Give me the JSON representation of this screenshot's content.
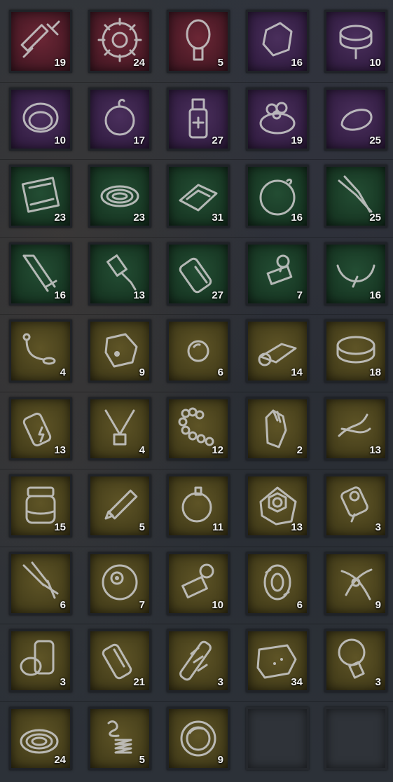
{
  "inventory": {
    "items": [
      {
        "icon": "syringe-icon",
        "rarity": "red",
        "count": "19"
      },
      {
        "icon": "gear-icon",
        "rarity": "red",
        "count": "24"
      },
      {
        "icon": "bulb-icon",
        "rarity": "red",
        "count": "5"
      },
      {
        "icon": "stone-icon",
        "rarity": "purple",
        "count": "16"
      },
      {
        "icon": "seal-icon",
        "rarity": "purple",
        "count": "10"
      },
      {
        "icon": "ring-band-icon",
        "rarity": "purple",
        "count": "10"
      },
      {
        "icon": "pendant-icon",
        "rarity": "purple",
        "count": "17"
      },
      {
        "icon": "medicine-bottle-icon",
        "rarity": "purple",
        "count": "27"
      },
      {
        "icon": "jeweled-ring-icon",
        "rarity": "purple",
        "count": "19"
      },
      {
        "icon": "wire-loop-icon",
        "rarity": "purple",
        "count": "25"
      },
      {
        "icon": "bandage-pack-icon",
        "rarity": "green",
        "count": "23"
      },
      {
        "icon": "rope-coil-icon",
        "rarity": "green",
        "count": "23"
      },
      {
        "icon": "gauze-pad-icon",
        "rarity": "green",
        "count": "31"
      },
      {
        "icon": "ornament-icon",
        "rarity": "green",
        "count": "16"
      },
      {
        "icon": "pliers-icon",
        "rarity": "green",
        "count": "25"
      },
      {
        "icon": "hacksaw-icon",
        "rarity": "green",
        "count": "16"
      },
      {
        "icon": "spark-plug-icon",
        "rarity": "green",
        "count": "13"
      },
      {
        "icon": "battery-icon",
        "rarity": "green",
        "count": "27"
      },
      {
        "icon": "stamp-icon",
        "rarity": "green",
        "count": "7"
      },
      {
        "icon": "necklace-icon",
        "rarity": "green",
        "count": "16"
      },
      {
        "icon": "beads-string-icon",
        "rarity": "yellow",
        "count": "4"
      },
      {
        "icon": "coin-tag-icon",
        "rarity": "yellow",
        "count": "9"
      },
      {
        "icon": "marble-icon",
        "rarity": "yellow",
        "count": "6"
      },
      {
        "icon": "cloth-roll-icon",
        "rarity": "yellow",
        "count": "14"
      },
      {
        "icon": "bracelet-icon",
        "rarity": "yellow",
        "count": "18"
      },
      {
        "icon": "cell-battery-icon",
        "rarity": "yellow",
        "count": "13"
      },
      {
        "icon": "light-fixture-icon",
        "rarity": "yellow",
        "count": "4"
      },
      {
        "icon": "prayer-beads-icon",
        "rarity": "yellow",
        "count": "12"
      },
      {
        "icon": "gloves-icon",
        "rarity": "yellow",
        "count": "2"
      },
      {
        "icon": "thread-icon",
        "rarity": "yellow",
        "count": "13"
      },
      {
        "icon": "jar-icon",
        "rarity": "yellow",
        "count": "15"
      },
      {
        "icon": "pencil-icon",
        "rarity": "yellow",
        "count": "5"
      },
      {
        "icon": "bomb-ornament-icon",
        "rarity": "yellow",
        "count": "11"
      },
      {
        "icon": "pillow-hex-nut-icon",
        "rarity": "yellow",
        "count": "13"
      },
      {
        "icon": "socket-icon",
        "rarity": "yellow",
        "count": "3"
      },
      {
        "icon": "clamp-icon",
        "rarity": "yellow",
        "count": "6"
      },
      {
        "icon": "eyeball-icon",
        "rarity": "yellow",
        "count": "7"
      },
      {
        "icon": "rubber-stamp-icon",
        "rarity": "yellow",
        "count": "10"
      },
      {
        "icon": "spool-icon",
        "rarity": "yellow",
        "count": "6"
      },
      {
        "icon": "ribbon-icon",
        "rarity": "yellow",
        "count": "9"
      },
      {
        "icon": "bandage-roll-icon",
        "rarity": "yellow",
        "count": "3"
      },
      {
        "icon": "aa-battery-icon",
        "rarity": "yellow",
        "count": "21"
      },
      {
        "icon": "tape-stick-icon",
        "rarity": "yellow",
        "count": "3"
      },
      {
        "icon": "rag-icon",
        "rarity": "yellow",
        "count": "34"
      },
      {
        "icon": "light-bulb-icon",
        "rarity": "yellow",
        "count": "3"
      },
      {
        "icon": "rope-bundle-icon",
        "rarity": "yellow",
        "count": "24"
      },
      {
        "icon": "spring-icon",
        "rarity": "yellow",
        "count": "5"
      },
      {
        "icon": "lens-icon",
        "rarity": "yellow",
        "count": "9"
      }
    ],
    "empty_slots": 2
  },
  "colors": {
    "red": "#4a1a26",
    "purple": "#351f45",
    "green": "#183824",
    "yellow": "#463f1b",
    "count_text": "#f2f2f2"
  }
}
